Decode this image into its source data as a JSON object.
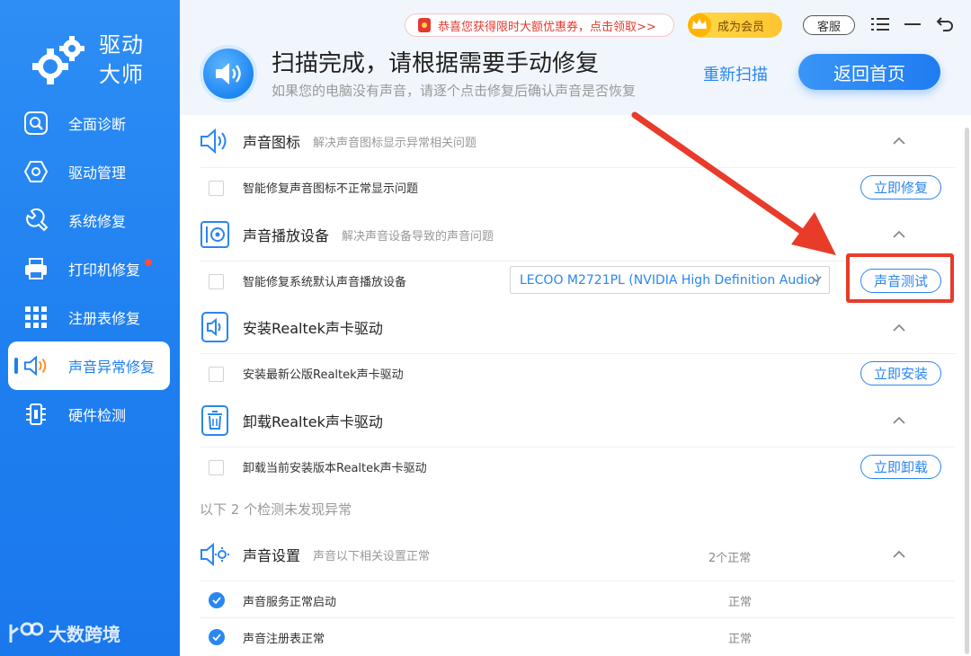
{
  "app": {
    "logo_line1": "驱动",
    "logo_line2": "大师"
  },
  "sidebar": {
    "items": [
      {
        "label": "全面诊断",
        "icon": "search-icon"
      },
      {
        "label": "驱动管理",
        "icon": "hexagon-icon"
      },
      {
        "label": "系统修复",
        "icon": "wrench-icon"
      },
      {
        "label": "打印机修复",
        "icon": "printer-icon",
        "badge": true
      },
      {
        "label": "注册表修复",
        "icon": "grid-icon"
      },
      {
        "label": "声音异常修复",
        "icon": "speaker-icon",
        "active": true
      },
      {
        "label": "硬件检测",
        "icon": "chip-icon"
      }
    ],
    "watermark": "大数跨境"
  },
  "header": {
    "promo": "恭喜您获得限时大额优惠券，点击领取>>",
    "vip": "成为会员",
    "kefu": "客服",
    "title": "扫描完成，请根据需要手动修复",
    "subtitle": "如果您的电脑没有声音，请逐个点击修复后确认声音是否恢复",
    "rescan": "重新扫描",
    "home": "返回首页"
  },
  "sections": [
    {
      "title": "声音图标",
      "desc": "解决声音图标显示异常相关问题",
      "row": "智能修复声音图标不正常显示问题",
      "action": "立即修复"
    },
    {
      "title": "声音播放设备",
      "desc": "解决声音设备导致的声音问题",
      "row": "智能修复系统默认声音播放设备",
      "device": "LECOO M2721PL (NVIDIA High Definition Audio)",
      "action": "声音测试"
    },
    {
      "title": "安装Realtek声卡驱动",
      "desc": "",
      "row": "安装最新公版Realtek声卡驱动",
      "action": "立即安装"
    },
    {
      "title": "卸载Realtek声卡驱动",
      "desc": "",
      "row": "卸载当前安装版本Realtek声卡驱动",
      "action": "立即卸载"
    }
  ],
  "normal": {
    "note": "以下 2 个检测未发现异常",
    "title": "声音设置",
    "desc": "声音以下相关设置正常",
    "count": "2个正常",
    "rows": [
      {
        "label": "声音服务正常启动",
        "status": "正常"
      },
      {
        "label": "声音注册表正常",
        "status": "正常"
      }
    ]
  },
  "colors": {
    "accent": "#1e7ff0",
    "highlight": "#e83b2a"
  }
}
